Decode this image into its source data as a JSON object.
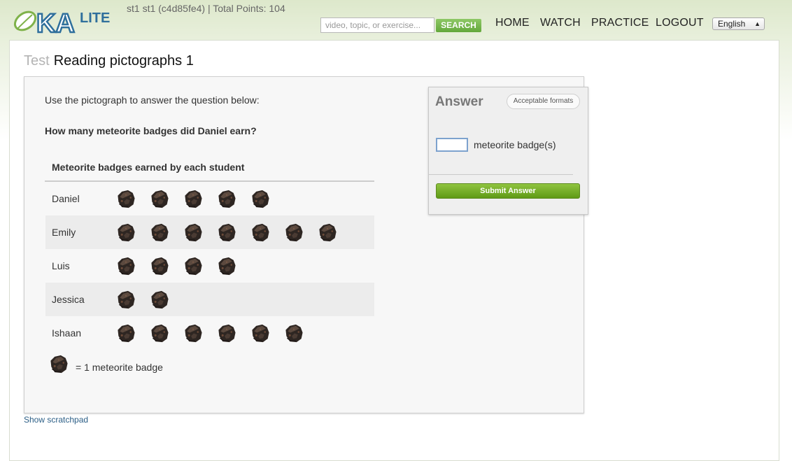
{
  "header": {
    "logo_text": "KALITE",
    "user_info": "st1 st1 (c4d85fe4) | Total Points: 104",
    "search": {
      "placeholder": "video, topic, or exercise...",
      "button_label": "SEARCH"
    },
    "nav": {
      "home": "HOME",
      "watch": "WATCH",
      "practice": "PRACTICE",
      "logout": "LOGOUT"
    },
    "language": "English"
  },
  "page": {
    "title_prefix": "Test",
    "title": "Reading pictographs 1"
  },
  "question": {
    "intro": "Use the pictograph to answer the question below:",
    "text": "How many meteorite badges did Daniel earn?"
  },
  "pictograph": {
    "title": "Meteorite badges earned by each student",
    "rows": [
      {
        "name": "Daniel",
        "count": 5
      },
      {
        "name": "Emily",
        "count": 7
      },
      {
        "name": "Luis",
        "count": 4
      },
      {
        "name": "Jessica",
        "count": 2
      },
      {
        "name": "Ishaan",
        "count": 6
      }
    ],
    "key_text": "= 1 meteorite badge"
  },
  "answer": {
    "title": "Answer",
    "formats_label": "Acceptable formats",
    "input_value": "",
    "unit": "meteorite badge(s)",
    "submit_label": "Submit Answer"
  },
  "footer": {
    "scratchpad_label": "Show scratchpad"
  },
  "icons": {
    "meteorite": "meteorite-icon",
    "logo_leaf": "leaf-icon"
  },
  "colors": {
    "accent_green": "#6aab3f",
    "logo_blue": "#2f6f9c",
    "link": "#2b5e86"
  }
}
